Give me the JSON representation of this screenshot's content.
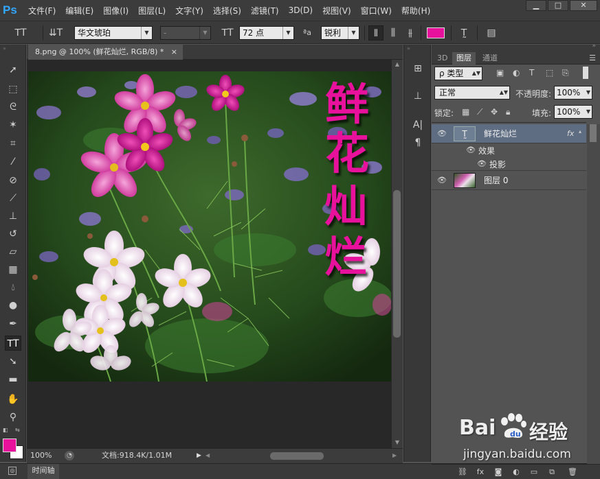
{
  "app": {
    "logo": "Ps"
  },
  "menu": [
    "文件(F)",
    "编辑(E)",
    "图像(I)",
    "图层(L)",
    "文字(Y)",
    "选择(S)",
    "滤镜(T)",
    "3D(D)",
    "视图(V)",
    "窗口(W)",
    "帮助(H)"
  ],
  "window_controls": {
    "minimize": "▁",
    "maximize": "□",
    "close": "✕"
  },
  "options": {
    "font_family": "华文琥珀",
    "font_style": "-",
    "font_size": "72 点",
    "aa_label": "ªa",
    "antialias": "锐利",
    "text_color": "#e8119c"
  },
  "document": {
    "tab_title": "8.png @ 100% (鲜花灿烂, RGB/8) *",
    "tab_close": "×",
    "canvas_text": [
      "鲜",
      "花",
      "灿",
      "烂"
    ],
    "canvas_text_color": "#e8119c"
  },
  "status": {
    "zoom": "100%",
    "doc_info": "文档:918.4K/1.01M"
  },
  "timeline": {
    "label": "时间轴"
  },
  "panel": {
    "tabs": [
      "3D",
      "图层",
      "通道"
    ],
    "active_tab": "图层",
    "filter_type": "ρ 类型",
    "blend_mode": "正常",
    "opacity_label": "不透明度:",
    "opacity_value": "100%",
    "lock_label": "锁定:",
    "fill_label": "填充:",
    "fill_value": "100%",
    "layers": [
      {
        "name": "鲜花灿烂",
        "fx": "fx",
        "selected": true
      },
      {
        "name": "效果",
        "sub": true
      },
      {
        "name": "投影",
        "sub2": true
      },
      {
        "name": "图层 0",
        "selected": false
      }
    ]
  },
  "watermark": {
    "brand": "Bai",
    "brand_cn": "经验",
    "url": "jingyan.baidu.com"
  },
  "colors": {
    "foreground": "#e8119c",
    "background": "#ffffff",
    "selection": "#5e6d82"
  }
}
